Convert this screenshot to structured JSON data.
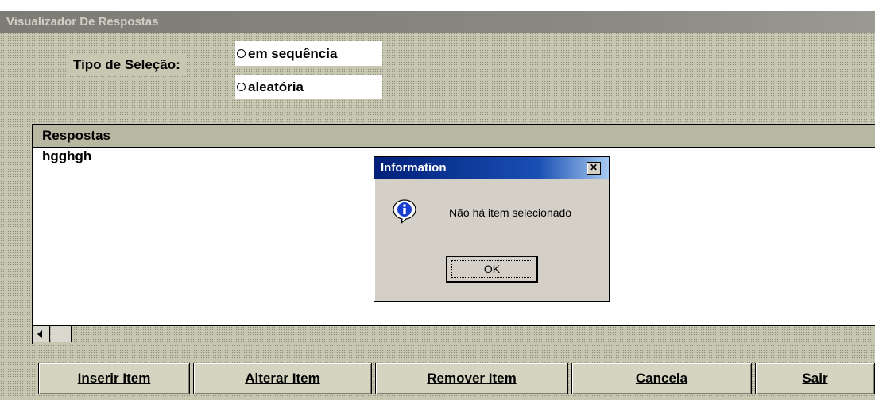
{
  "window": {
    "title": "Visualizador De Respostas"
  },
  "selection": {
    "label": "Tipo de Seleção:",
    "options": [
      "em sequência",
      "aleatória"
    ]
  },
  "answers": {
    "header": "Respostas",
    "items": [
      "hgghgh"
    ]
  },
  "buttons": {
    "insert": "Inserir Item",
    "alter": "Alterar Item",
    "remove": "Remover Item",
    "cancel": "Cancela",
    "exit": "Sair"
  },
  "dialog": {
    "title": "Information",
    "close_glyph": "✕",
    "message": "Não há item selecionado",
    "ok": "OK",
    "icon": "info-icon"
  }
}
